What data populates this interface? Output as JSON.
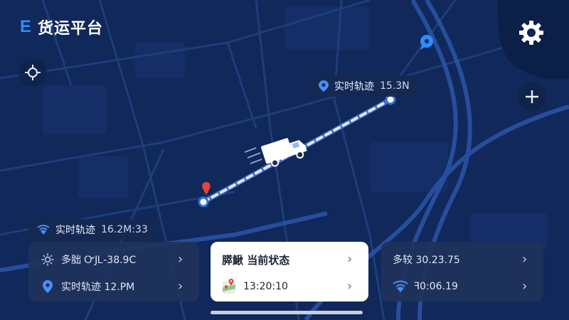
{
  "app": {
    "logo_letter": "E",
    "title": "货运平台"
  },
  "colors": {
    "route": "#bcd2ff",
    "accent": "#2f8bff",
    "origin_pin": "#e8443a",
    "background": "#0f2550"
  },
  "map": {
    "top_label": {
      "icon": "location-pin-icon",
      "text": "实时轨迹",
      "value": "15.3N"
    },
    "left_label": {
      "icon": "wifi-signal-icon",
      "text": "实时轨迹",
      "value": "16.2M:33"
    }
  },
  "cards": {
    "left": [
      {
        "icon": "sun-icon",
        "text": "多胐 ᏅJᏞ-38.9C"
      },
      {
        "icon": "location-pin-icon",
        "text": "实时轨迹 12.PM"
      }
    ],
    "center": [
      {
        "icon": "",
        "text": "膵鰍 当前状态"
      },
      {
        "icon": "map-pin-icon",
        "text": "13:20:10"
      }
    ],
    "right": [
      {
        "icon": "",
        "text": "多较 30.23.75"
      },
      {
        "icon": "wifi-signal-icon",
        "text": "ꟻ0:06.19"
      }
    ]
  }
}
